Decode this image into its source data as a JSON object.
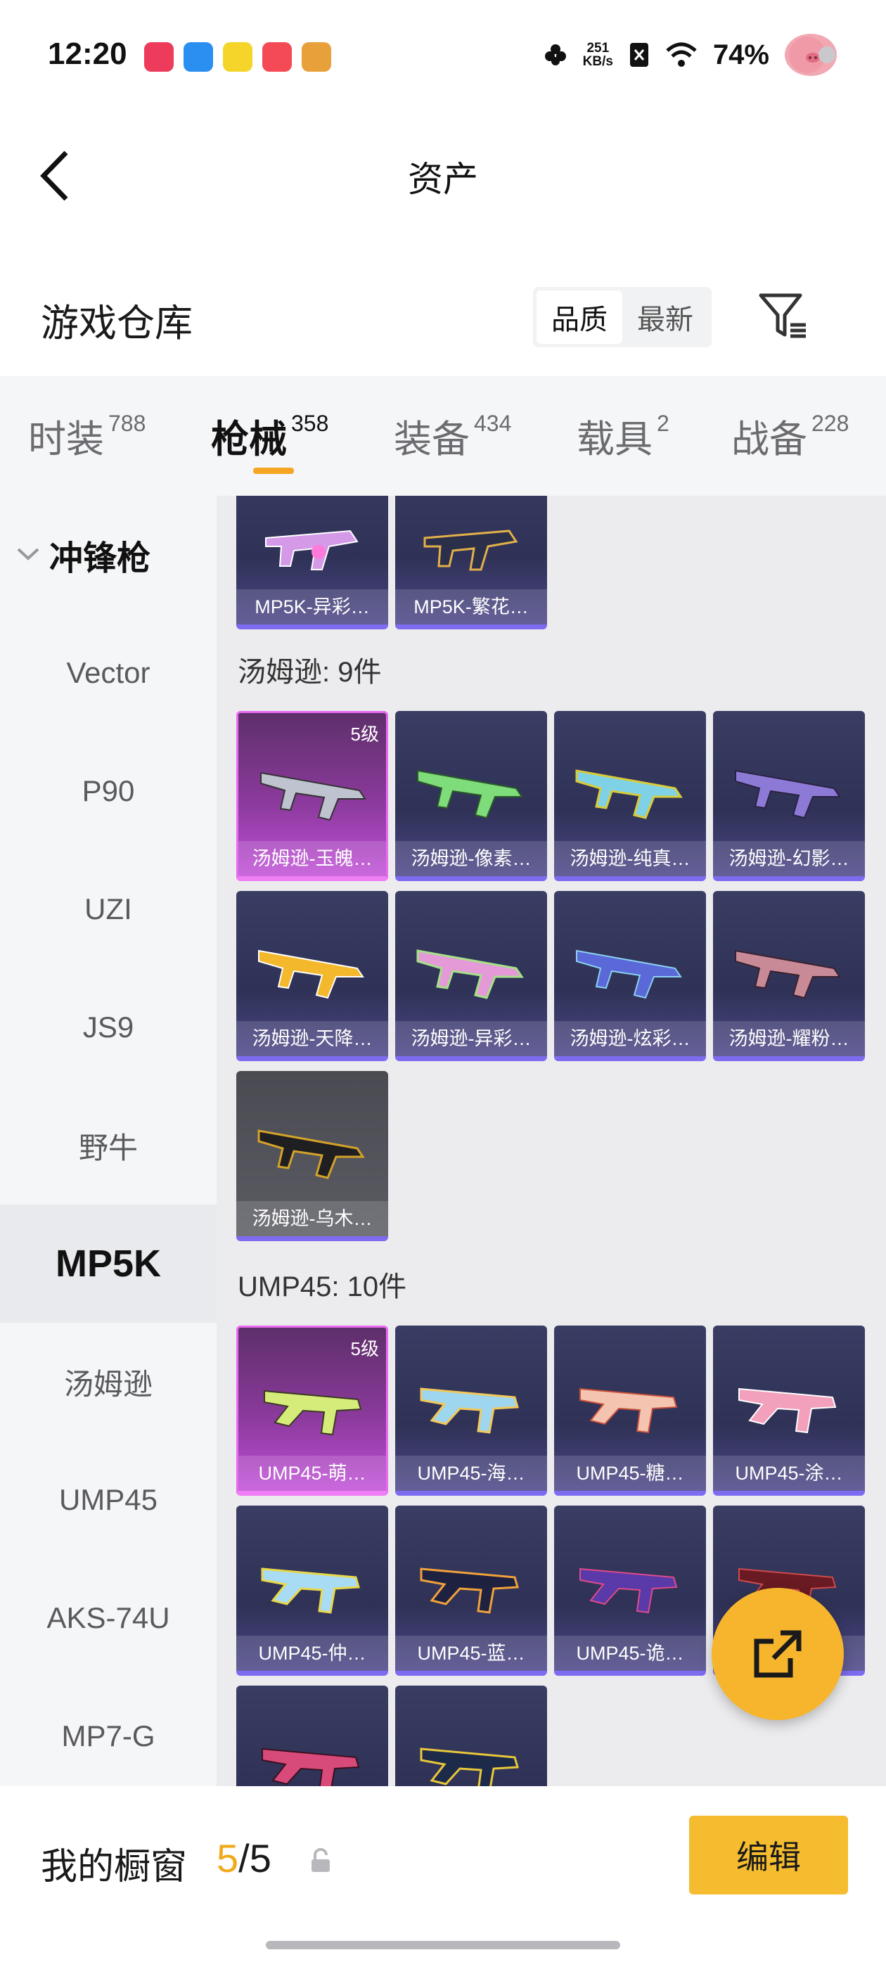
{
  "status_bar": {
    "time": "12:20",
    "net_speed_value": "251",
    "net_speed_unit": "KB/s",
    "battery": "74%",
    "app_icons": [
      "video-app-icon",
      "browser-app-icon",
      "yellow-app-icon",
      "red-app-icon",
      "news-app-icon"
    ]
  },
  "header": {
    "title": "资产"
  },
  "warehouse": {
    "title": "游戏仓库",
    "sort_options": [
      "品质",
      "最新"
    ],
    "active_sort": "品质"
  },
  "tabs": [
    {
      "label": "时装",
      "count": "788"
    },
    {
      "label": "枪械",
      "count": "358",
      "active": true
    },
    {
      "label": "装备",
      "count": "434"
    },
    {
      "label": "载具",
      "count": "2"
    },
    {
      "label": "战备",
      "count": "228"
    }
  ],
  "sidebar": {
    "group": "冲锋枪",
    "items": [
      "Vector",
      "P90",
      "UZI",
      "JS9",
      "野牛",
      "MP5K",
      "汤姆逊",
      "UMP45",
      "AKS-74U",
      "MP7-G"
    ],
    "active": "MP5K"
  },
  "content": {
    "mp5k_cards": [
      "MP5K-异彩…",
      "MP5K-繁花…"
    ],
    "thompson": {
      "header": "汤姆逊: 9件",
      "cards": [
        {
          "name": "汤姆逊-玉魄…",
          "tier": "5级"
        },
        {
          "name": "汤姆逊-像素…"
        },
        {
          "name": "汤姆逊-纯真…"
        },
        {
          "name": "汤姆逊-幻影…"
        },
        {
          "name": "汤姆逊-天降…"
        },
        {
          "name": "汤姆逊-异彩…"
        },
        {
          "name": "汤姆逊-炫彩…"
        },
        {
          "name": "汤姆逊-耀粉…"
        },
        {
          "name": "汤姆逊-乌木…"
        }
      ]
    },
    "ump45": {
      "header": "UMP45: 10件",
      "cards": [
        {
          "name": "UMP45-萌…",
          "tier": "5级"
        },
        {
          "name": "UMP45-海…"
        },
        {
          "name": "UMP45-糖…"
        },
        {
          "name": "UMP45-涂…"
        },
        {
          "name": "UMP45-仲…"
        },
        {
          "name": "UMP45-蓝…"
        },
        {
          "name": "UMP45-诡…"
        },
        {
          "name": ""
        },
        {
          "name": ""
        },
        {
          "name": ""
        }
      ]
    }
  },
  "bottom_bar": {
    "label": "我的橱窗",
    "current": "5",
    "separator": "/",
    "max": "5",
    "edit_label": "编辑"
  },
  "colors": {
    "accent": "#f4bc2e",
    "tab_underline": "#f5a623",
    "card_bottom": "#7d6cf0",
    "gold_card": "#c14fd8"
  }
}
